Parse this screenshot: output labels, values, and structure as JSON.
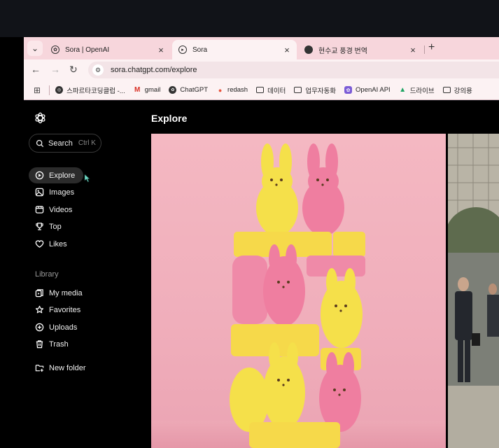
{
  "browser": {
    "tabs": [
      {
        "title": "Sora | OpenAI",
        "active": false
      },
      {
        "title": "Sora",
        "active": true
      },
      {
        "title": "현수교 풍경 번역",
        "active": false
      }
    ],
    "url": "sora.chatgpt.com/explore",
    "bookmarks": [
      {
        "label": "스파르타코딩클럽 -...",
        "icon": "globe-icon"
      },
      {
        "label": "gmail",
        "icon": "gmail-icon"
      },
      {
        "label": "ChatGPT",
        "icon": "openai-icon"
      },
      {
        "label": "redash",
        "icon": "redash-icon"
      },
      {
        "label": "데이터",
        "icon": "folder-icon"
      },
      {
        "label": "업무자동화",
        "icon": "folder-icon"
      },
      {
        "label": "OpenAI API",
        "icon": "openai-api-icon"
      },
      {
        "label": "드라이브",
        "icon": "drive-icon"
      },
      {
        "label": "강의용",
        "icon": "folder-icon"
      }
    ]
  },
  "sidebar": {
    "search_label": "Search",
    "search_shortcut": "Ctrl K",
    "nav": [
      {
        "label": "Explore",
        "icon": "explore-icon",
        "active": true
      },
      {
        "label": "Images",
        "icon": "images-icon"
      },
      {
        "label": "Videos",
        "icon": "videos-icon"
      },
      {
        "label": "Top",
        "icon": "trophy-icon"
      },
      {
        "label": "Likes",
        "icon": "heart-icon"
      }
    ],
    "library_label": "Library",
    "library": [
      {
        "label": "My media",
        "icon": "media-icon"
      },
      {
        "label": "Favorites",
        "icon": "star-icon"
      },
      {
        "label": "Uploads",
        "icon": "upload-icon"
      },
      {
        "label": "Trash",
        "icon": "trash-icon"
      }
    ],
    "new_folder_label": "New folder"
  },
  "main": {
    "title": "Explore"
  }
}
